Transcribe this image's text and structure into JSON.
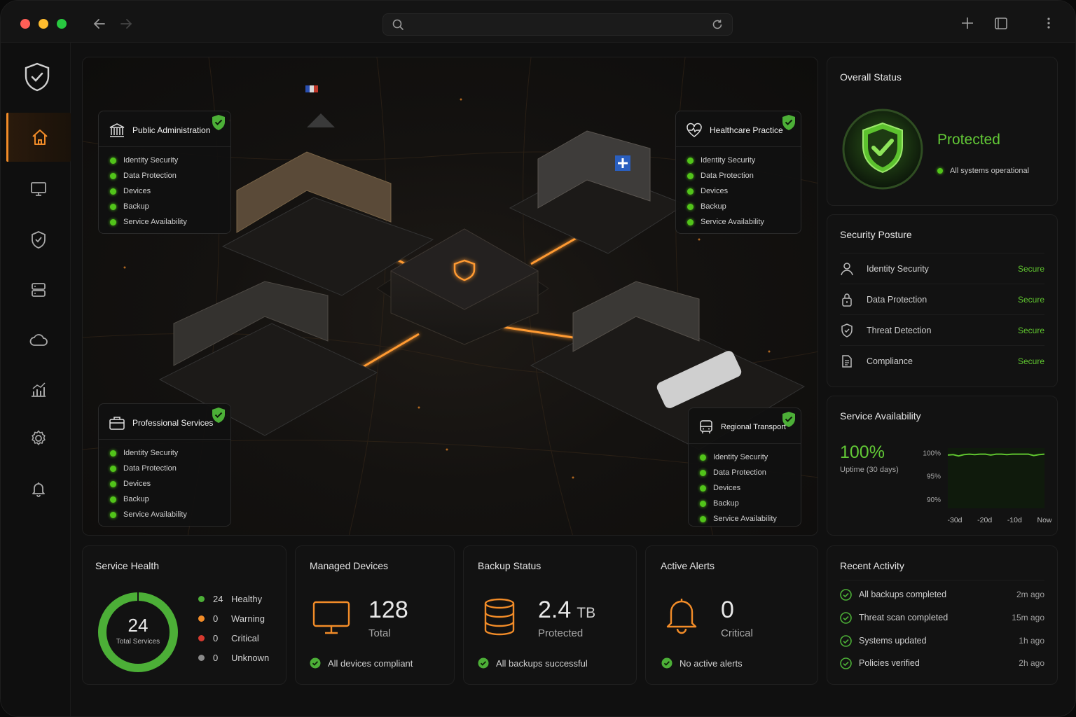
{
  "map": {
    "sites": [
      {
        "title": "Public Administration",
        "items": [
          "Identity Security",
          "Data Protection",
          "Devices",
          "Backup",
          "Service Availability"
        ]
      },
      {
        "title": "Healthcare Practice",
        "items": [
          "Identity Security",
          "Data Protection",
          "Devices",
          "Backup",
          "Service Availability"
        ]
      },
      {
        "title": "Professional Services",
        "items": [
          "Identity Security",
          "Data Protection",
          "Devices",
          "Backup",
          "Service Availability"
        ]
      },
      {
        "title": "Regional Transport",
        "items": [
          "Identity Security",
          "Data Protection",
          "Devices",
          "Backup",
          "Service Availability"
        ]
      }
    ]
  },
  "overall": {
    "title": "Overall Status",
    "status": "Protected",
    "note": "All systems operational"
  },
  "posture": {
    "title": "Security Posture",
    "rows": [
      {
        "label": "Identity Security",
        "value": "Secure",
        "icon": "user-icon"
      },
      {
        "label": "Data Protection",
        "value": "Secure",
        "icon": "lock-icon"
      },
      {
        "label": "Threat Detection",
        "value": "Secure",
        "icon": "shield-icon"
      },
      {
        "label": "Compliance",
        "value": "Secure",
        "icon": "document-icon"
      }
    ]
  },
  "availability": {
    "title": "Service Availability",
    "value": "100%",
    "caption": "Uptime (30 days)",
    "chart_data": {
      "type": "line",
      "x": [
        "-30d",
        "-20d",
        "-10d",
        "Now"
      ],
      "yticks": [
        "100%",
        "95%",
        "90%"
      ],
      "ylim": [
        88,
        101
      ],
      "series": [
        {
          "values": [
            99.5,
            99.6,
            99.3,
            99.6,
            99.7,
            99.6,
            99.7,
            99.7,
            99.5,
            99.7,
            99.7,
            99.6,
            99.7,
            99.7,
            99.7,
            99.7,
            99.4,
            99.6,
            99.7
          ]
        }
      ]
    }
  },
  "health": {
    "title": "Service Health",
    "total": "24",
    "total_label": "Total Services",
    "legend": [
      {
        "count": "24",
        "label": "Healthy",
        "color": "#4caf37"
      },
      {
        "count": "0",
        "label": "Warning",
        "color": "#f28c28"
      },
      {
        "count": "0",
        "label": "Critical",
        "color": "#d63a2f"
      },
      {
        "count": "0",
        "label": "Unknown",
        "color": "#8a8a8a"
      }
    ]
  },
  "devices": {
    "title": "Managed Devices",
    "value": "128",
    "caption": "Total",
    "note": "All devices compliant"
  },
  "backup": {
    "title": "Backup Status",
    "value": "2.4",
    "unit": "TB",
    "caption": "Protected",
    "note": "All backups successful"
  },
  "alerts": {
    "title": "Active Alerts",
    "value": "0",
    "caption": "Critical",
    "note": "No active alerts"
  },
  "activity": {
    "title": "Recent Activity",
    "rows": [
      {
        "label": "All backups completed",
        "time": "2m ago"
      },
      {
        "label": "Threat scan completed",
        "time": "15m ago"
      },
      {
        "label": "Systems updated",
        "time": "1h ago"
      },
      {
        "label": "Policies verified",
        "time": "2h ago"
      }
    ]
  },
  "colors": {
    "accent": "#f28c28",
    "ok": "#52c41a"
  }
}
